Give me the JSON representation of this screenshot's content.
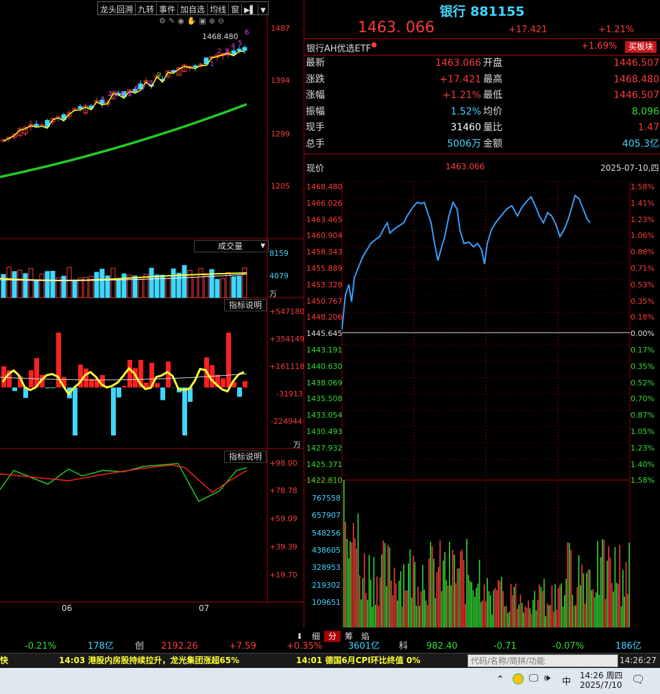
{
  "toolbar": {
    "items": [
      "龙头回溯",
      "九转",
      "事件",
      "加自选",
      "均线",
      "窗"
    ],
    "icons": [
      "settings-icon",
      "pen-icon",
      "eye-icon",
      "hand-icon",
      "lock-icon",
      "plus-icon",
      "minus-icon"
    ]
  },
  "kline": {
    "price_labels": [
      "1487",
      "1394",
      "1299",
      "1205"
    ],
    "high_marker": "1468.480",
    "nine_turn": [
      "1",
      "2",
      "3",
      "4",
      "5",
      "6",
      "7",
      "8",
      "9",
      "1",
      "2",
      "3",
      "4",
      "5",
      "6"
    ]
  },
  "volume_panel": {
    "title": "成交量",
    "labels": [
      "8159",
      "4079"
    ],
    "unit": "万"
  },
  "indicator1": {
    "button": "指标说明",
    "labels": [
      "+547180",
      "+354149",
      "+161118",
      "-31913",
      "-224944"
    ],
    "unit": "万"
  },
  "indicator2": {
    "button": "指标说明",
    "labels": [
      "+98.00",
      "+78.78",
      "+59.09",
      "+39.39",
      "+19.70"
    ]
  },
  "date_axis": [
    "06",
    "07"
  ],
  "header": {
    "name": "银行",
    "code": "881155",
    "price": "1463. 066",
    "change": "+17.421",
    "change_pct": "+1.21%",
    "related": "银行AH优选ETF",
    "related_pct": "+1.69%",
    "buy_block": "买板块"
  },
  "info": [
    {
      "k1": "最新",
      "v1": "1463.066",
      "k2": "开盘",
      "v2": "1446.507"
    },
    {
      "k1": "涨跌",
      "v1": "+17.421",
      "k2": "最高",
      "v2": "1468.480"
    },
    {
      "k1": "涨幅",
      "v1": "+1.21%",
      "k2": "最低",
      "v2": "1446.507"
    },
    {
      "k1": "振幅",
      "v1": "1.52%",
      "k2": "均价",
      "v2": "8.096"
    },
    {
      "k1": "现手",
      "v1": "31460",
      "k2": "量比",
      "v2": "1.47"
    },
    {
      "k1": "总手",
      "v1": "5006万",
      "k2": "金额",
      "v2": "405.3亿"
    }
  ],
  "intraday": {
    "label": "现价",
    "price": "1463.066",
    "date": "2025-07-10,四",
    "left_axis": [
      "1468.480",
      "1466.026",
      "1463.465",
      "1460.904",
      "1458.343",
      "1455.889",
      "1453.328",
      "1450.767",
      "1448.206",
      "1445.645",
      "1443.191",
      "1440.630",
      "1438.069",
      "1435.508",
      "1433.054",
      "1430.493",
      "1427.932",
      "1425.371",
      "1422.810"
    ],
    "right_axis": [
      "1.58%",
      "1.41%",
      "1.23%",
      "1.06%",
      "0.88%",
      "0.71%",
      "0.53%",
      "0.35%",
      "0.18%",
      "0.00%",
      "0.17%",
      "0.35%",
      "0.52%",
      "0.70%",
      "0.87%",
      "1.05%",
      "1.23%",
      "1.40%",
      "1.58%"
    ],
    "vol_axis": [
      "767558",
      "657907",
      "548256",
      "438605",
      "328953",
      "219302",
      "109651"
    ]
  },
  "bottom_tabs": [
    "细",
    "分",
    "筹",
    "焰"
  ],
  "index_bar": {
    "a_pct": "-0.21%",
    "a_amt": "178亿",
    "b_name": "创",
    "b_val": "2192.26",
    "b_chg": "+7.59",
    "b_pct": "+0.35%",
    "b_amt": "3601亿",
    "c_name": "科",
    "c_val": "982.40",
    "c_chg": "-0.71",
    "c_pct": "-0.07%",
    "c_amt": "186亿"
  },
  "news": {
    "left_frag": "快",
    "n1": "14:03 港股内房股持续拉升，龙光集团涨超65%",
    "n2": "14:01 德国6月CPI环比终值 0%",
    "search_placeholder": "代码/名称/简拼/功能",
    "clock": "14:26:27"
  },
  "taskbar": {
    "ime": "中",
    "time": "14:26 周四",
    "date": "2025/7/10"
  },
  "colors": {
    "up": "#ff3b3b",
    "down": "#33dd33",
    "line": "#3aa0ff",
    "accent": "#3fd7ff"
  }
}
